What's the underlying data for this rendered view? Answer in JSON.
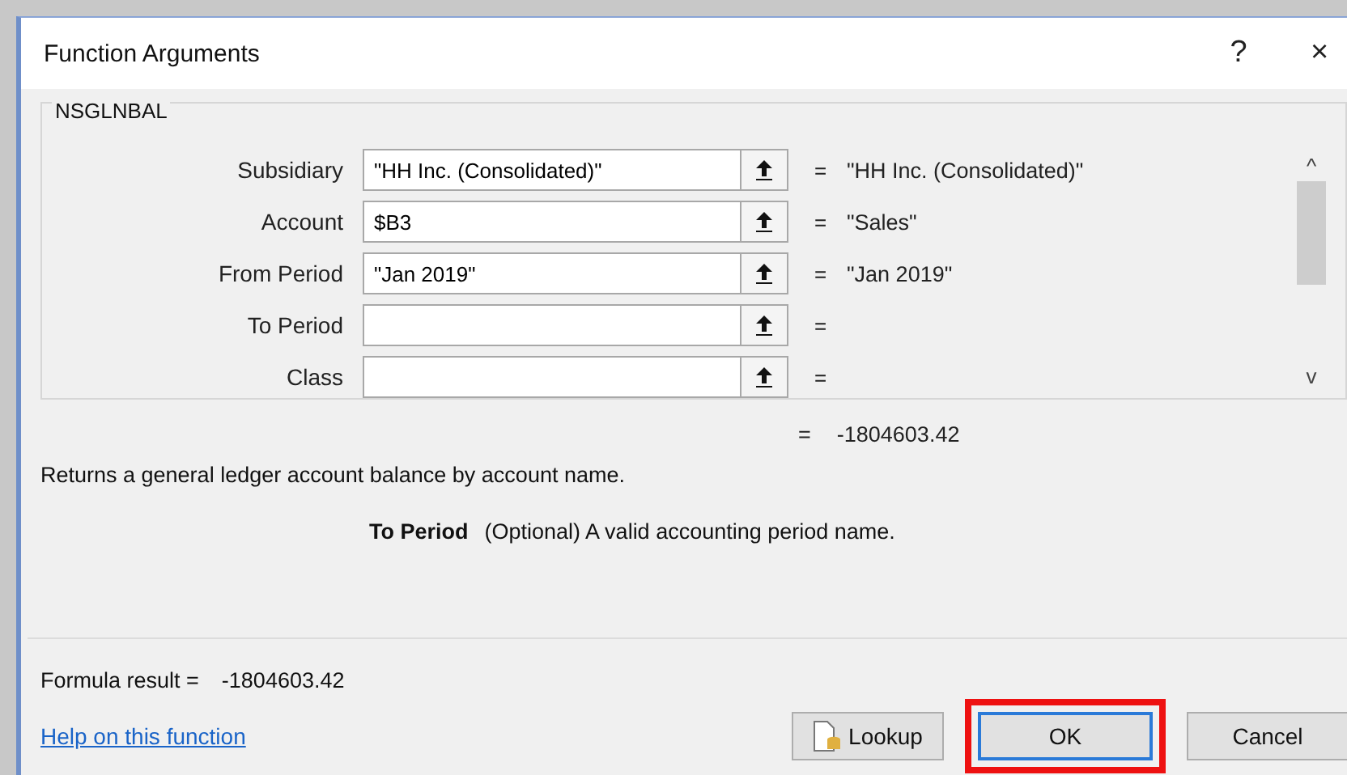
{
  "window": {
    "title": "Function Arguments",
    "controls": [
      "?",
      "×"
    ]
  },
  "function_name": "NSGLNBAL",
  "arguments": [
    {
      "label": "Subsidiary",
      "value": "\"HH Inc. (Consolidated)\"",
      "equals": "=",
      "result": "\"HH Inc. (Consolidated)\""
    },
    {
      "label": "Account",
      "value": "$B3",
      "equals": "=",
      "result": "\"Sales\""
    },
    {
      "label": "From Period",
      "value": "\"Jan 2019\"",
      "equals": "=",
      "result": "\"Jan 2019\""
    },
    {
      "label": "To Period",
      "equals": "="
    },
    {
      "label": "Class",
      "equals": "="
    }
  ],
  "scroll": {
    "up": "^",
    "down": "v"
  },
  "result": {
    "equals": "=",
    "value": "-1804603.42"
  },
  "description": "Returns a general ledger account balance by account name.",
  "param_help": {
    "name": "To Period",
    "text": "(Optional) A valid accounting period name."
  },
  "formula_result": {
    "label": "Formula result =",
    "value": "-1804603.42"
  },
  "help_link": "Help on this function",
  "buttons": [
    {
      "label": "Lookup",
      "kind": "lookup",
      "highlighted": false
    },
    {
      "label": "OK",
      "kind": "default",
      "highlighted": true
    },
    {
      "label": "Cancel",
      "kind": "plain",
      "highlighted": false
    }
  ]
}
